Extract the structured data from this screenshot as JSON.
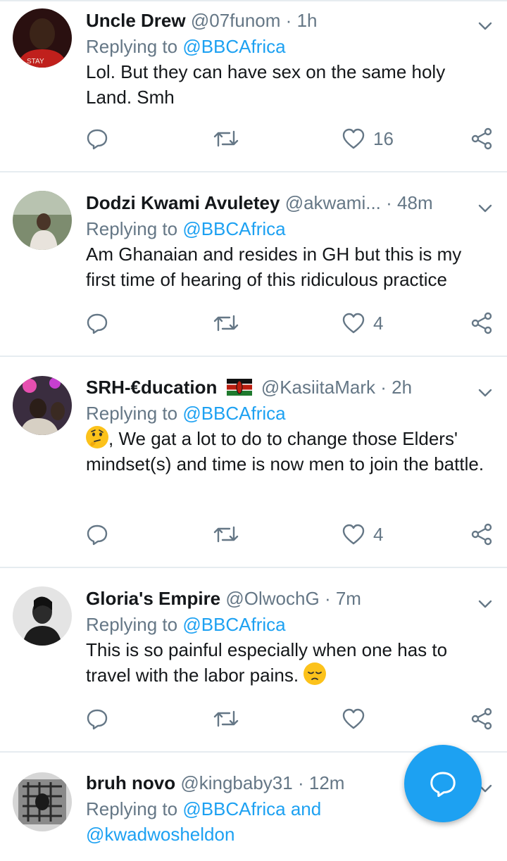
{
  "icons": {
    "reply": "speech-bubble-icon",
    "retweet": "retweet-icon",
    "like": "heart-icon",
    "share": "share-icon",
    "menu": "chevron-down-icon",
    "compose": "compose-reply-icon"
  },
  "colors": {
    "accent": "#1da1f2",
    "muted": "#657786",
    "text": "#14171a",
    "divider": "#e6ecf0"
  },
  "tweets": [
    {
      "name": "Uncle Drew",
      "handle": "@07funom",
      "sep": "·",
      "time": "1h",
      "replying_prefix": "Replying to",
      "replying_to": "@BBCAfrica",
      "text": "Lol. But they can have sex on the same holy Land. Smh",
      "likes": "16"
    },
    {
      "name": "Dodzi Kwami Avuletey",
      "handle": "@akwami...",
      "sep": "·",
      "time": "48m",
      "replying_prefix": "Replying to",
      "replying_to": "@BBCAfrica",
      "text": "Am Ghanaian and resides in GH but this is my first time of hearing of this ridiculous practice",
      "likes": "4"
    },
    {
      "name": "SRH-€ducation",
      "handle": "@KasiitaMark",
      "sep": "·",
      "time": "2h",
      "replying_prefix": "Replying to",
      "replying_to": "@BBCAfrica",
      "text": ", We gat a lot to do to change those Elders' mindset(s) and time is now men to join the battle.",
      "likes": "4"
    },
    {
      "name": "Gloria's Empire",
      "handle": "@OlwochG",
      "sep": "·",
      "time": "7m",
      "replying_prefix": "Replying to",
      "replying_to": "@BBCAfrica",
      "text": "This is so painful especially when one has to travel with the labor pains.",
      "likes": ""
    },
    {
      "name": "bruh novo",
      "handle": "@kingbaby31",
      "sep": "·",
      "time": "12m",
      "replying_prefix": "Replying to",
      "replying_to": "@BBCAfrica and",
      "replying_to_2": "@kwadwosheldon"
    }
  ]
}
